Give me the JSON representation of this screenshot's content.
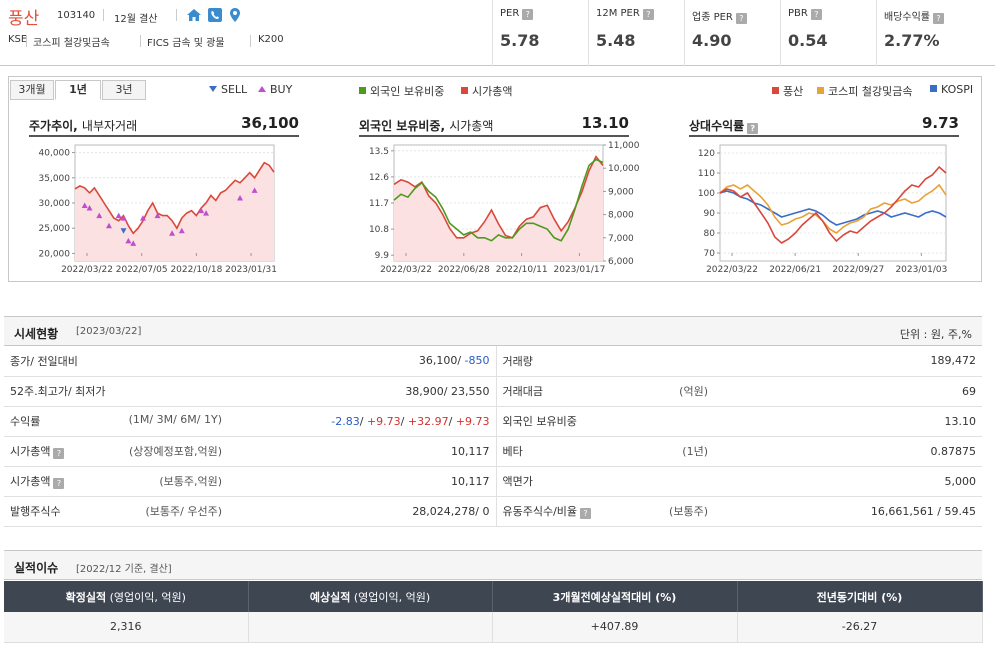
{
  "company": {
    "name": "풍산",
    "code": "103140",
    "fiscal": "12월 결산",
    "market": "KSE",
    "sector1": "코스피 철강및금속",
    "sector2": "FICS 금속 및 광물",
    "index": "K200"
  },
  "metrics": [
    {
      "label": "PER",
      "value": "5.78"
    },
    {
      "label": "12M PER",
      "value": "5.48"
    },
    {
      "label": "업종 PER",
      "value": "4.90"
    },
    {
      "label": "PBR",
      "value": "0.54"
    },
    {
      "label": "배당수익률",
      "value": "2.77%"
    }
  ],
  "metric_help": "?",
  "chart_tabs": [
    "3개월",
    "1년",
    "3년"
  ],
  "active_tab": "1년",
  "legends": {
    "sell": "SELL",
    "buy": "BUY",
    "foreign": "외국인 보유비중",
    "marketcap": "시가총액",
    "poongsan": "풍산",
    "sector": "코스피 철강및금속",
    "kospi": "KOSPI"
  },
  "colors": {
    "red": "#d9483b",
    "green": "#4e9a1e",
    "orange": "#e8a23a",
    "blue": "#3a6ec6",
    "buy": "#c04fd0"
  },
  "chart_data": [
    {
      "type": "line",
      "title": "주가추이",
      "subtitle": "내부자거래",
      "value": "36,100",
      "yticks": [
        "40,000",
        "35,000",
        "30,000",
        "25,000",
        "20,000"
      ],
      "ylim": [
        18500,
        41500
      ],
      "xticks": [
        "2022/03/22",
        "2022/07/05",
        "2022/10/18",
        "2023/01/31"
      ],
      "series": [
        {
          "name": "",
          "values": [
            32800,
            33400,
            33000,
            32000,
            33000,
            31500,
            30000,
            28500,
            27000,
            26500,
            27500,
            25500,
            24000,
            25000,
            26500,
            28500,
            30000,
            28000,
            27500,
            27500,
            26500,
            25000,
            27000,
            28000,
            28500,
            27500,
            29000,
            30000,
            31500,
            30500,
            32000,
            32500,
            33500,
            34500,
            34000,
            35000,
            36000,
            35000,
            36500,
            38000,
            37500,
            36100
          ]
        }
      ],
      "buy_markers": [
        [
          2,
          29500
        ],
        [
          3,
          29000
        ],
        [
          5,
          27500
        ],
        [
          7,
          25500
        ],
        [
          9,
          27500
        ],
        [
          10,
          27000
        ],
        [
          11,
          22500
        ],
        [
          12,
          22000
        ],
        [
          14,
          27000
        ],
        [
          17,
          27500
        ],
        [
          20,
          24000
        ],
        [
          22,
          24500
        ],
        [
          26,
          28500
        ],
        [
          27,
          28000
        ],
        [
          34,
          31000
        ],
        [
          37,
          32500
        ]
      ],
      "sell_markers": [
        [
          10,
          24500
        ]
      ]
    },
    {
      "type": "line",
      "title": "외국인 보유비중",
      "subtitle": "시가총액",
      "value": "13.10",
      "yticks_left": [
        "13.5",
        "12.6",
        "11.7",
        "10.8",
        "9.9"
      ],
      "ylim_left": [
        9.7,
        13.7
      ],
      "yticks_right": [
        "11,000",
        "10,000",
        "9,000",
        "8,000",
        "7,000",
        "6,000"
      ],
      "ylim_right": [
        6000,
        11000
      ],
      "xticks": [
        "2022/03/22",
        "2022/06/28",
        "2022/10/11",
        "2023/01/17"
      ],
      "series": [
        {
          "name": "외국인 보유비중",
          "values": [
            11.8,
            12.0,
            11.9,
            12.2,
            12.4,
            12.1,
            11.9,
            11.5,
            11.0,
            10.8,
            10.6,
            10.7,
            10.5,
            10.5,
            10.4,
            10.6,
            10.5,
            10.5,
            10.8,
            11.0,
            11.0,
            10.9,
            10.8,
            10.5,
            10.4,
            10.8,
            11.5,
            12.3,
            13.0,
            13.2,
            13.1
          ]
        },
        {
          "name": "시가총액",
          "values": [
            9300,
            9500,
            9400,
            9200,
            9400,
            8800,
            8500,
            8000,
            7400,
            7000,
            7000,
            7200,
            7300,
            7700,
            8200,
            7600,
            7100,
            7000,
            7500,
            7800,
            7900,
            8300,
            8400,
            7800,
            7300,
            7700,
            8300,
            9000,
            9900,
            10500,
            10117
          ]
        }
      ]
    },
    {
      "type": "line",
      "title": "상대수익률",
      "subtitle": "",
      "value": "9.73",
      "yticks": [
        "120",
        "110",
        "100",
        "90",
        "80",
        "70"
      ],
      "ylim": [
        66,
        124
      ],
      "xticks": [
        "2022/03/22",
        "2022/06/21",
        "2022/09/27",
        "2023/01/03"
      ],
      "series": [
        {
          "name": "풍산",
          "values": [
            100,
            102,
            101,
            98,
            100,
            95,
            90,
            85,
            78,
            75,
            77,
            80,
            84,
            87,
            90,
            86,
            80,
            76,
            79,
            81,
            80,
            83,
            86,
            88,
            90,
            93,
            97,
            101,
            104,
            103,
            107,
            109,
            113,
            110
          ]
        },
        {
          "name": "코스피 철강및금속",
          "values": [
            100,
            103,
            104,
            102,
            104,
            101,
            98,
            94,
            88,
            84,
            85,
            87,
            88,
            90,
            89,
            86,
            82,
            80,
            83,
            85,
            86,
            88,
            92,
            93,
            95,
            94,
            96,
            97,
            95,
            96,
            99,
            101,
            104,
            99
          ]
        },
        {
          "name": "KOSPI",
          "values": [
            100,
            101,
            100,
            98,
            97,
            95,
            94,
            92,
            90,
            88,
            89,
            90,
            91,
            92,
            91,
            89,
            86,
            84,
            85,
            86,
            87,
            89,
            90,
            91,
            90,
            88,
            89,
            90,
            89,
            88,
            90,
            91,
            90,
            88
          ]
        }
      ]
    }
  ],
  "stat_section": {
    "title": "시세현황",
    "date": "[2023/03/22]",
    "unit": "단위 : 원, 주,%"
  },
  "stat_rows": [
    {
      "l1": "종가/ 전일대비",
      "q1": "",
      "v1a": "36,100/ ",
      "v1b": "-850",
      "l2": "거래량",
      "q2": "",
      "v2": "189,472"
    },
    {
      "l1": "52주.최고가/ 최저가",
      "q1": "",
      "v1a": "38,900/ 23,550",
      "v1b": "",
      "l2": "거래대금",
      "q2": "(억원)",
      "v2": "69"
    },
    {
      "l1": "수익률",
      "q1": "(1M/ 3M/ 6M/ 1Y)",
      "r1": "-2.83",
      "r2": "+9.73",
      "r3": "+32.97",
      "r4": "+9.73",
      "l2": "외국인 보유비중",
      "q2": "",
      "v2": "13.10"
    },
    {
      "l1": "시가총액",
      "q1": "(상장예정포함,억원)",
      "v1a": "10,117",
      "v1b": "",
      "l2": "베타",
      "q2": "(1년)",
      "v2": "0.87875"
    },
    {
      "l1": "시가총액",
      "q1": "(보통주,억원)",
      "v1a": "10,117",
      "v1b": "",
      "l2": "액면가",
      "q2": "",
      "v2": "5,000"
    },
    {
      "l1": "발행주식수",
      "q1": "(보통주/ 우선주)",
      "v1a": "28,024,278/ 0",
      "v1b": "",
      "l2": "유동주식수/비율",
      "q2": "(보통주)",
      "v2": "16,661,561 / 59.45"
    }
  ],
  "earn_section": {
    "title": "실적이슈",
    "sub": "[2022/12 기준, 결산]"
  },
  "earn_headers": [
    {
      "main": "확정실적",
      "sub": " (영업이익, 억원)"
    },
    {
      "main": "예상실적",
      "sub": " (영업이익, 억원)"
    },
    {
      "main": "3개월전예상실적대비 (%)",
      "sub": ""
    },
    {
      "main": "전년동기대비 (%)",
      "sub": ""
    }
  ],
  "earn_values": [
    "2,316",
    "",
    "+407.89",
    "-26.27"
  ]
}
